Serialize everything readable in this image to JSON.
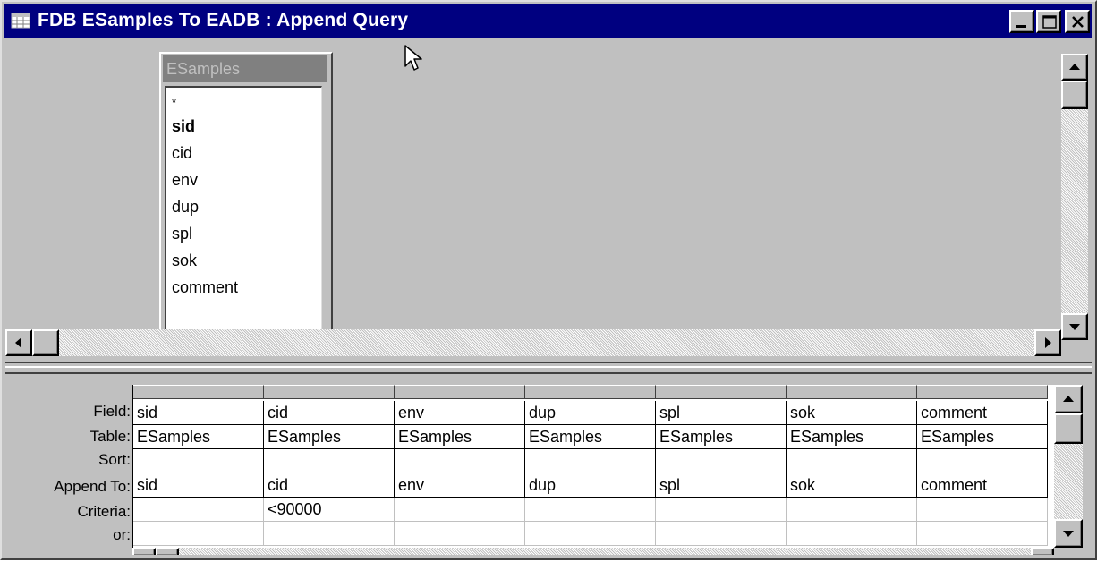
{
  "window": {
    "title": "FDB ESamples To EADB : Append Query",
    "icon": "query-icon"
  },
  "field_list": {
    "table_name": "ESamples",
    "items": [
      {
        "label": "*",
        "style": "star"
      },
      {
        "label": "sid",
        "style": "key"
      },
      {
        "label": "cid",
        "style": "normal"
      },
      {
        "label": "env",
        "style": "normal"
      },
      {
        "label": "dup",
        "style": "normal"
      },
      {
        "label": "spl",
        "style": "normal"
      },
      {
        "label": "sok",
        "style": "normal"
      },
      {
        "label": "comment",
        "style": "normal"
      }
    ]
  },
  "grid": {
    "row_labels": {
      "field": "Field:",
      "table": "Table:",
      "sort": "Sort:",
      "append_to": "Append To:",
      "criteria": "Criteria:",
      "or": "or:"
    },
    "columns": [
      {
        "field": "sid",
        "table": "ESamples",
        "sort": "",
        "append_to": "sid",
        "criteria": "",
        "or": ""
      },
      {
        "field": "cid",
        "table": "ESamples",
        "sort": "",
        "append_to": "cid",
        "criteria": "<90000",
        "or": ""
      },
      {
        "field": "env",
        "table": "ESamples",
        "sort": "",
        "append_to": "env",
        "criteria": "",
        "or": ""
      },
      {
        "field": "dup",
        "table": "ESamples",
        "sort": "",
        "append_to": "dup",
        "criteria": "",
        "or": ""
      },
      {
        "field": "spl",
        "table": "ESamples",
        "sort": "",
        "append_to": "spl",
        "criteria": "",
        "or": ""
      },
      {
        "field": "sok",
        "table": "ESamples",
        "sort": "",
        "append_to": "sok",
        "criteria": "",
        "or": ""
      },
      {
        "field": "comment",
        "table": "ESamples",
        "sort": "",
        "append_to": "comment",
        "criteria": "",
        "or": ""
      }
    ]
  },
  "colors": {
    "titlebar": "#000080",
    "face": "#c0c0c0",
    "field_list_title": "#808080"
  }
}
